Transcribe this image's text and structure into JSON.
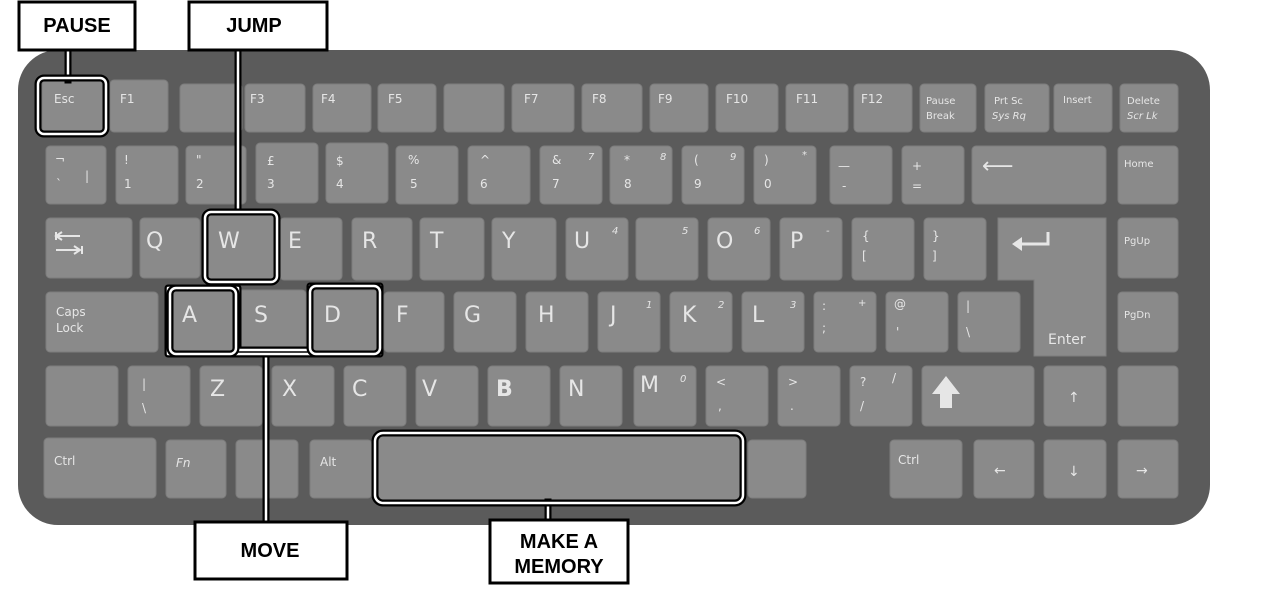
{
  "callouts": {
    "pause": "PAUSE",
    "jump": "JUMP",
    "move": "MOVE",
    "memory_line1": "MAKE A",
    "memory_line2": "MEMORY"
  },
  "keys": {
    "row1": [
      "Esc",
      "F1",
      "",
      "F3",
      "F4",
      "F5",
      "",
      "F7",
      "F8",
      "F9",
      "F10",
      "F11",
      "F12",
      "Pause",
      "Break",
      "Prt Sc",
      "Sys Rq",
      "Insert",
      "Delete",
      "Scr Lk"
    ],
    "row2": [
      "¬",
      "`",
      "|",
      "!",
      "1",
      "\"",
      "2",
      "£",
      "3",
      "$",
      "4",
      "%",
      "5",
      "^",
      "6",
      "&",
      "7",
      "7",
      "*",
      "8",
      "8",
      "(",
      "9",
      "9",
      ")",
      "0",
      "*",
      "—",
      "-",
      "+",
      "=",
      "⟵",
      "Home"
    ],
    "row3": [
      "Q",
      "W",
      "E",
      "R",
      "T",
      "Y",
      "U",
      "4",
      "5",
      "O",
      "6",
      "P",
      "-",
      "{",
      "[",
      "}",
      "]",
      "PgUp"
    ],
    "row4": [
      "Caps",
      "Lock",
      "A",
      "S",
      "D",
      "F",
      "G",
      "H",
      "J",
      "1",
      "K",
      "2",
      "L",
      "3",
      ":",
      "+",
      ";",
      "@",
      "'",
      "|",
      "\\",
      "Enter",
      "PgDn"
    ],
    "row5": [
      "|",
      "\\",
      "Z",
      "X",
      "C",
      "V",
      "B",
      "N",
      "M",
      "0",
      "<",
      ",",
      ">",
      ".",
      "?",
      "/",
      "/",
      "↑"
    ],
    "row6": [
      "Ctrl",
      "Fn",
      "Alt",
      "Ctrl",
      "←",
      "↓",
      "→"
    ]
  }
}
